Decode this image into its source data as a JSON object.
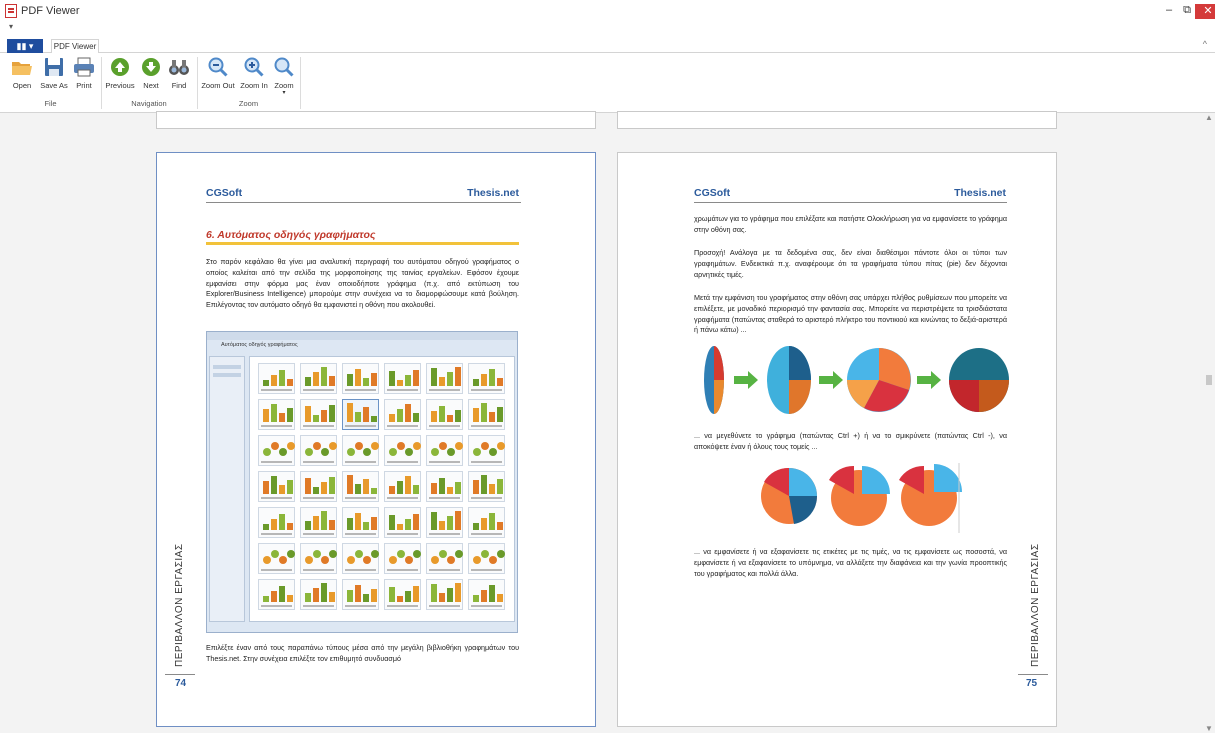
{
  "window": {
    "title": "PDF Viewer",
    "minimize_label": "–",
    "restore_label": "⧉",
    "close_label": "✕"
  },
  "qat": {
    "label": "▾"
  },
  "tabs": {
    "app_menu_label": "▮▮ ▾",
    "active_tab": "PDF Viewer",
    "collapse_label": "^"
  },
  "ribbon": {
    "buttons": [
      {
        "label": "Open",
        "icon": "folder-icon"
      },
      {
        "label": "Save As",
        "icon": "save-icon"
      },
      {
        "label": "Print",
        "icon": "printer-icon"
      },
      {
        "label": "Previous",
        "icon": "arrow-up-icon"
      },
      {
        "label": "Next",
        "icon": "arrow-down-icon"
      },
      {
        "label": "Find",
        "icon": "binoculars-icon"
      },
      {
        "label": "Zoom Out",
        "icon": "zoom-out-icon"
      },
      {
        "label": "Zoom In",
        "icon": "zoom-in-icon"
      },
      {
        "label": "Zoom",
        "icon": "zoom-icon"
      }
    ],
    "groups": {
      "file": "File",
      "navigation": "Navigation",
      "zoom": "Zoom"
    },
    "zoom_dropdown": "▾"
  },
  "colors": {
    "accent": "#2c5b9c",
    "chapter": "#c0392b",
    "rule": "#f2c23a",
    "ribbon_icon": "#4f89c9",
    "nav_green": "#5aa02c"
  },
  "page_left": {
    "header_left": "CGSoft",
    "header_right": "Thesis.net",
    "chapter_title": "6. Αυτόματος οδηγός γραφήματος",
    "intro": "Στο παρόν κεφάλαιο θα γίνει μια αναλυτική περιγραφή του αυτόματου οδηγού γραφήματος ο οποίος καλείται από την σελίδα της μορφοποίησης της ταινίας εργαλείων. Εφόσον έχουμε εμφανίσει στην φόρμα μας έναν οποιοδήποτε γράφημα (π.χ. από εκτύπωση του Explorer/Business Intelligence) μπορούμε στην συνέχεια να το διαμορφώσουμε κατά βούληση. Επιλέγοντας τον αυτόματο οδηγό θα εμφανιστεί η οθόνη που ακολουθεί.",
    "screenshot_title": "Αυτόματος οδηγός γραφήματος",
    "footer": "Επιλέξτε έναν από τους παραπάνω τύπους μέσα από την μεγάλη βιβλιοθήκη γραφημάτων του Thesis.net. Στην συνέχεια επιλέξτε τον επιθυμητό συνδυασμό",
    "side_label": "ΠΕΡΙΒΑΛΛΟΝ ΕΡΓΑΣΙΑΣ",
    "page_number": "74"
  },
  "page_right": {
    "header_left": "CGSoft",
    "header_right": "Thesis.net",
    "p1": "χρωμάτων για το γράφημα που επιλέξατε και πατήστε Ολοκλήρωση για να εμφανίσετε το γράφημα στην οθόνη σας.",
    "p2": "Προσοχή! Ανάλογα με τα δεδομένα σας, δεν είναι διαθέσιμοι πάντοτε όλοι οι τύποι των γραφημάτων. Ενδεικτικά π.χ. αναφέρουμε ότι τα γραφήματα τύπου πίτας (pie) δεν δέχονται αρνητικές τιμές.",
    "p3": "Μετά την εμφάνιση του γραφήματος στην οθόνη σας υπάρχει πλήθος ρυθμίσεων που μπορείτε να επιλέξετε, με μοναδικό περιορισμό την φαντασία σας. Μπορείτε να περιστρέψετε τα τρισδιάστατα γραφήματα (πατώντας σταθερά το αριστερό πλήκτρο του ποντικιού και κινώντας το δεξιά-αριστερά ή πάνω κάτω) ...",
    "p4": "... να μεγεθύνετε το γράφημα (πατώντας Ctrl +) ή να το σμικρύνετε (πατώντας Ctrl -), να αποκόψετε έναν ή όλους τους τομείς ...",
    "p5": "... να εμφανίσετε ή να εξαφανίσετε τις ετικέτες με τις τιμές, να τις εμφανίσετε ως ποσοστά, να εμφανίσετε ή να εξαφανίσετε το υπόμνημα, να αλλάξετε την διαφάνεια και την γωνία προοπτικής του γραφήματος και πολλά άλλα.",
    "side_label": "ΠΕΡΙΒΑΛΛΟΝ ΕΡΓΑΣΙΑΣ",
    "page_number": "75"
  }
}
